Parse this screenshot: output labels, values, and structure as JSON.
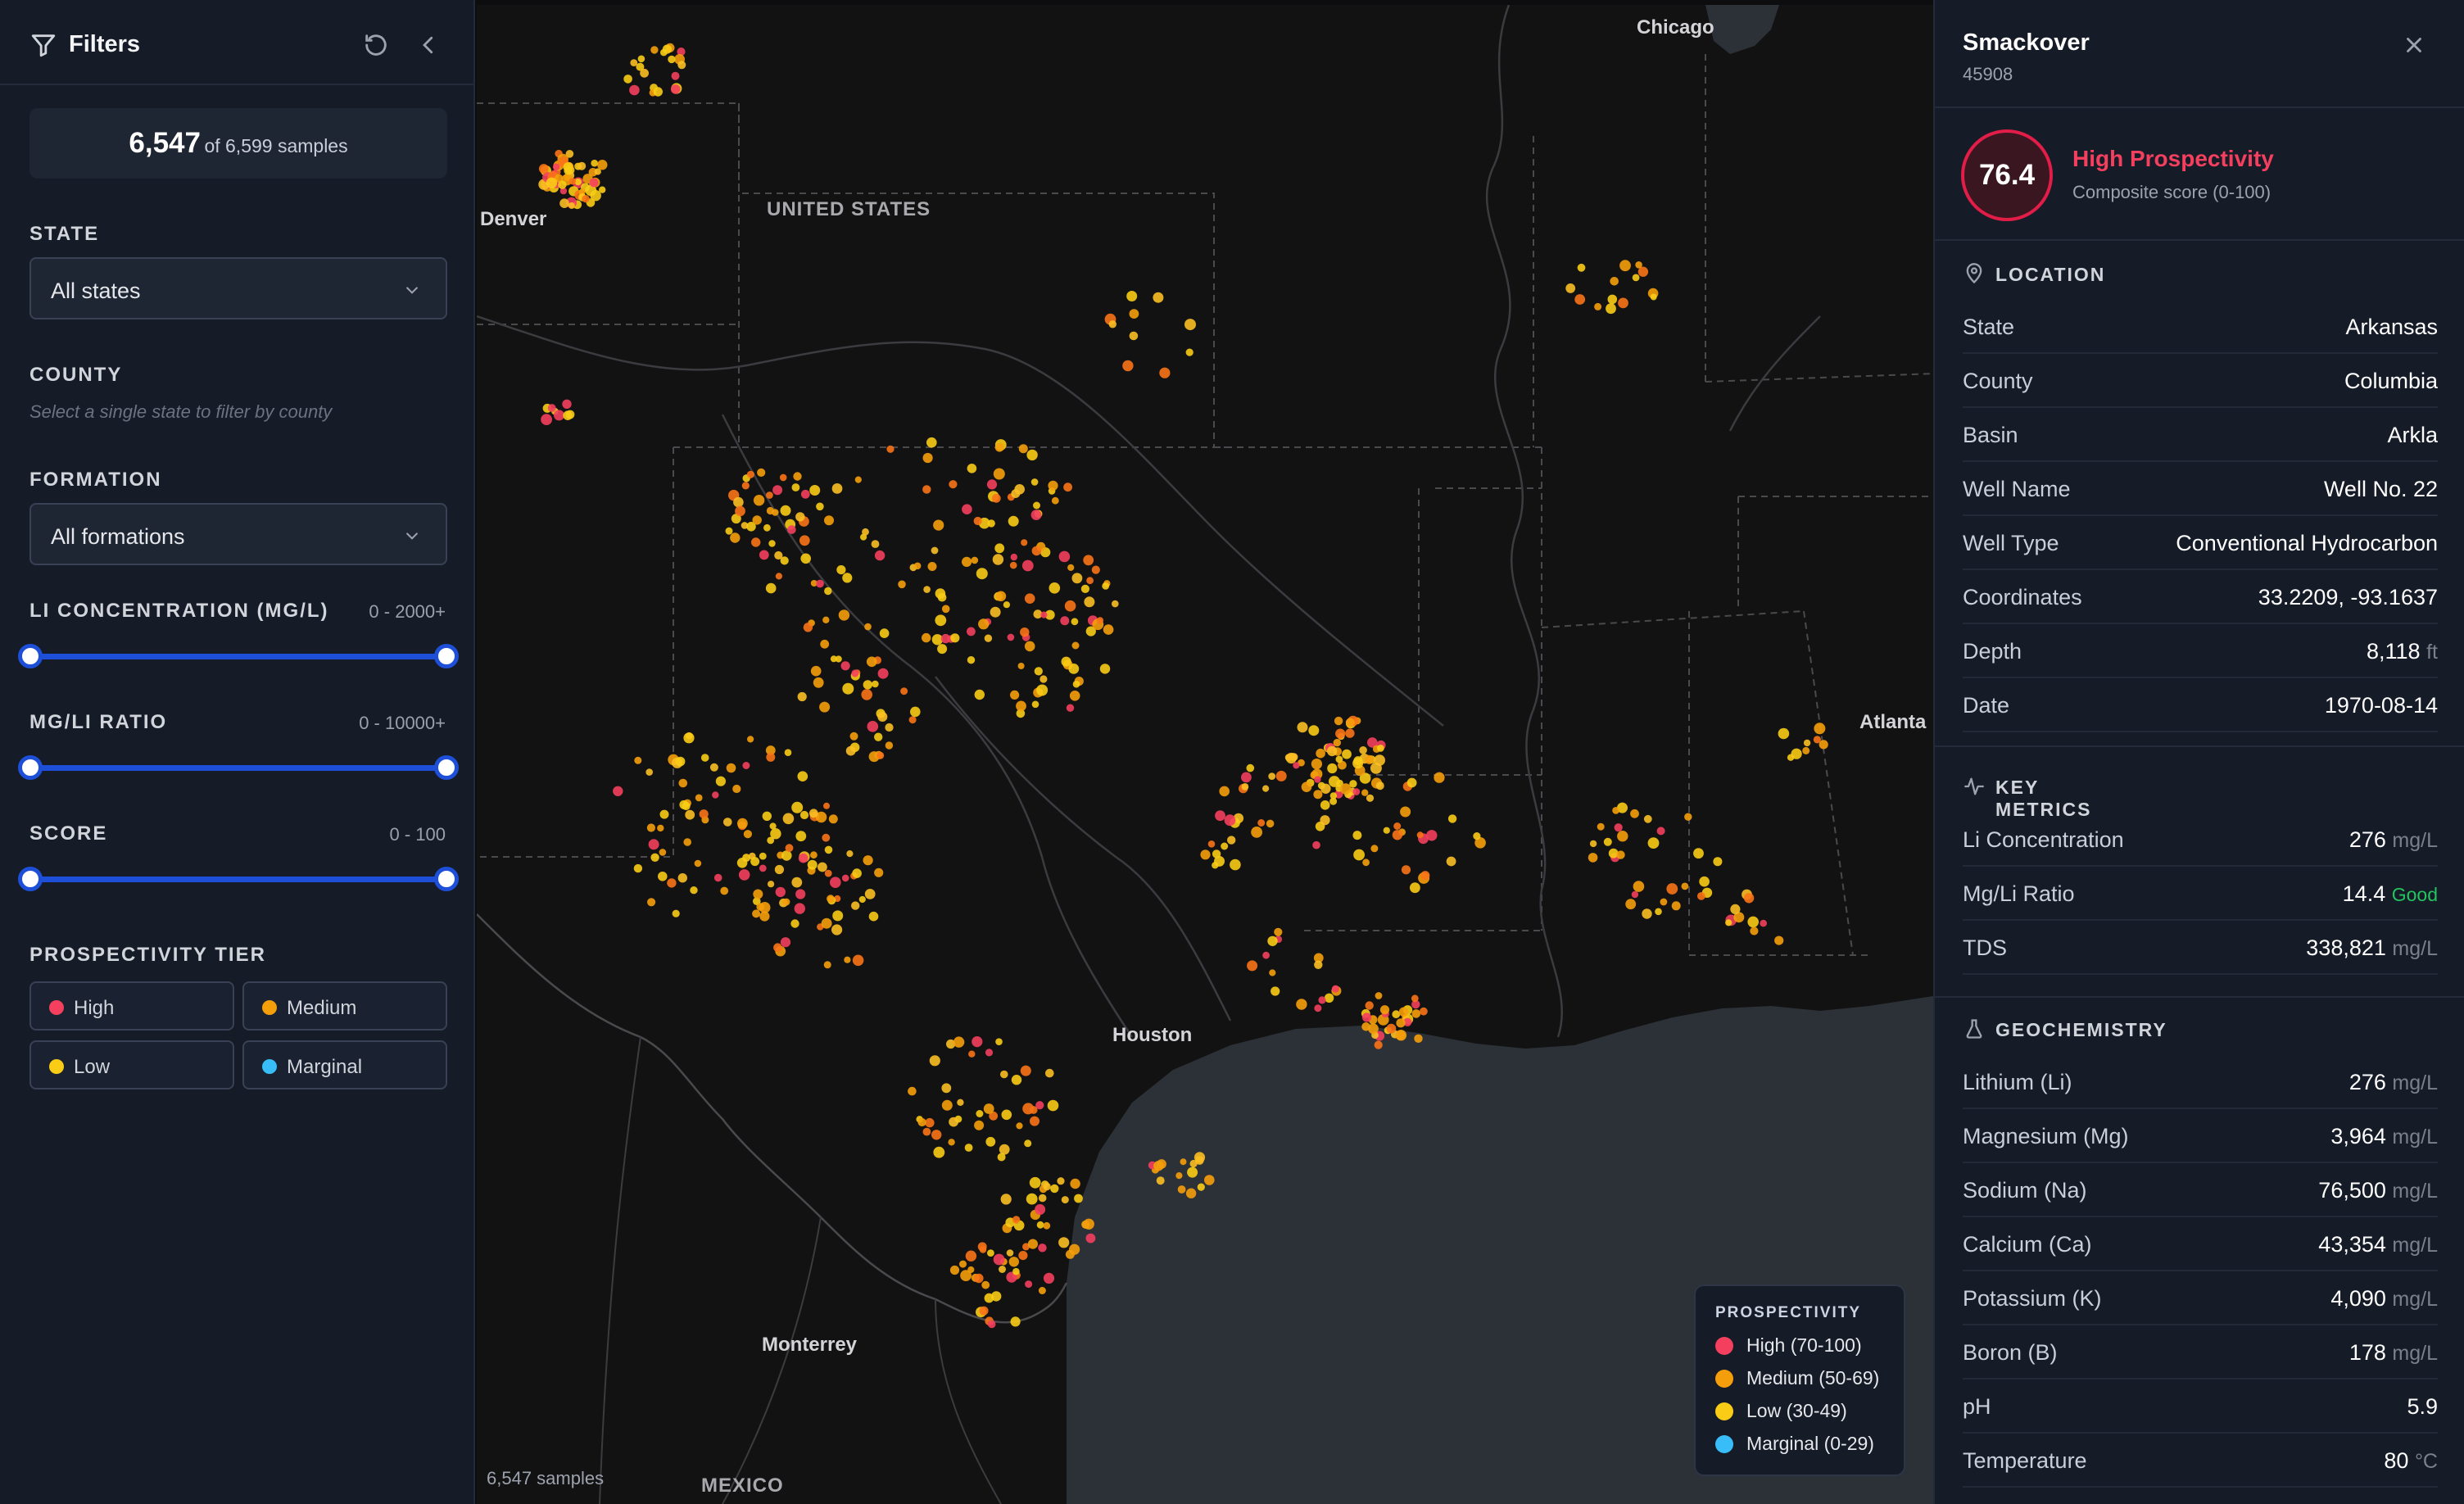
{
  "filters": {
    "title": "Filters",
    "count_shown": "6,547",
    "count_suffix": "of 6,599 samples",
    "state_label": "STATE",
    "state_value": "All states",
    "county_label": "COUNTY",
    "county_hint": "Select a single state to filter by county",
    "formation_label": "FORMATION",
    "formation_value": "All formations",
    "li_label": "LI CONCENTRATION (MG/L)",
    "li_range": "0 - 2000+",
    "mgli_label": "MG/LI RATIO",
    "mgli_range": "0 - 10000+",
    "score_label": "SCORE",
    "score_range": "0 - 100",
    "tier_label": "PROSPECTIVITY TIER",
    "tiers": [
      {
        "label": "High",
        "color": "#f43f5e"
      },
      {
        "label": "Medium",
        "color": "#f59e0b"
      },
      {
        "label": "Low",
        "color": "#facc15"
      },
      {
        "label": "Marginal",
        "color": "#38bdf8"
      }
    ]
  },
  "map": {
    "cities": [
      "Chicago",
      "Denver",
      "Atlanta",
      "Houston",
      "Monterrey"
    ],
    "countries": [
      "UNITED STATES",
      "MEXICO"
    ],
    "samples_note": "6,547 samples",
    "legend_title": "PROSPECTIVITY",
    "legend": [
      {
        "label": "High (70-100)",
        "color": "#f43f5e"
      },
      {
        "label": "Medium (50-69)",
        "color": "#f59e0b"
      },
      {
        "label": "Low (30-49)",
        "color": "#facc15"
      },
      {
        "label": "Marginal (0-29)",
        "color": "#38bdf8"
      }
    ]
  },
  "detail": {
    "name": "Smackover",
    "id": "45908",
    "score": "76.4",
    "tier": "High Prospectivity",
    "score_sub": "Composite score (0-100)",
    "location_title": "LOCATION",
    "location": [
      {
        "k": "State",
        "v": "Arkansas",
        "u": ""
      },
      {
        "k": "County",
        "v": "Columbia",
        "u": ""
      },
      {
        "k": "Basin",
        "v": "Arkla",
        "u": ""
      },
      {
        "k": "Well Name",
        "v": "Well No. 22",
        "u": ""
      },
      {
        "k": "Well Type",
        "v": "Conventional Hydrocarbon",
        "u": ""
      },
      {
        "k": "Coordinates",
        "v": "33.2209, -93.1637",
        "u": ""
      },
      {
        "k": "Depth",
        "v": "8,118",
        "u": "ft"
      },
      {
        "k": "Date",
        "v": "1970-08-14",
        "u": ""
      }
    ],
    "metrics_title": "KEY METRICS",
    "metrics": [
      {
        "k": "Li Concentration",
        "v": "276",
        "u": "mg/L"
      },
      {
        "k": "Mg/Li Ratio",
        "v": "14.4",
        "u": "",
        "badge": "Good"
      },
      {
        "k": "TDS",
        "v": "338,821",
        "u": "mg/L"
      }
    ],
    "geo_title": "GEOCHEMISTRY",
    "geo": [
      {
        "k": "Lithium (Li)",
        "v": "276",
        "u": "mg/L"
      },
      {
        "k": "Magnesium (Mg)",
        "v": "3,964",
        "u": "mg/L"
      },
      {
        "k": "Sodium (Na)",
        "v": "76,500",
        "u": "mg/L"
      },
      {
        "k": "Calcium (Ca)",
        "v": "43,354",
        "u": "mg/L"
      },
      {
        "k": "Potassium (K)",
        "v": "4,090",
        "u": "mg/L"
      },
      {
        "k": "Boron (B)",
        "v": "178",
        "u": "mg/L"
      },
      {
        "k": "pH",
        "v": "5.9",
        "u": ""
      },
      {
        "k": "Temperature",
        "v": "80",
        "u": "°C"
      }
    ]
  }
}
